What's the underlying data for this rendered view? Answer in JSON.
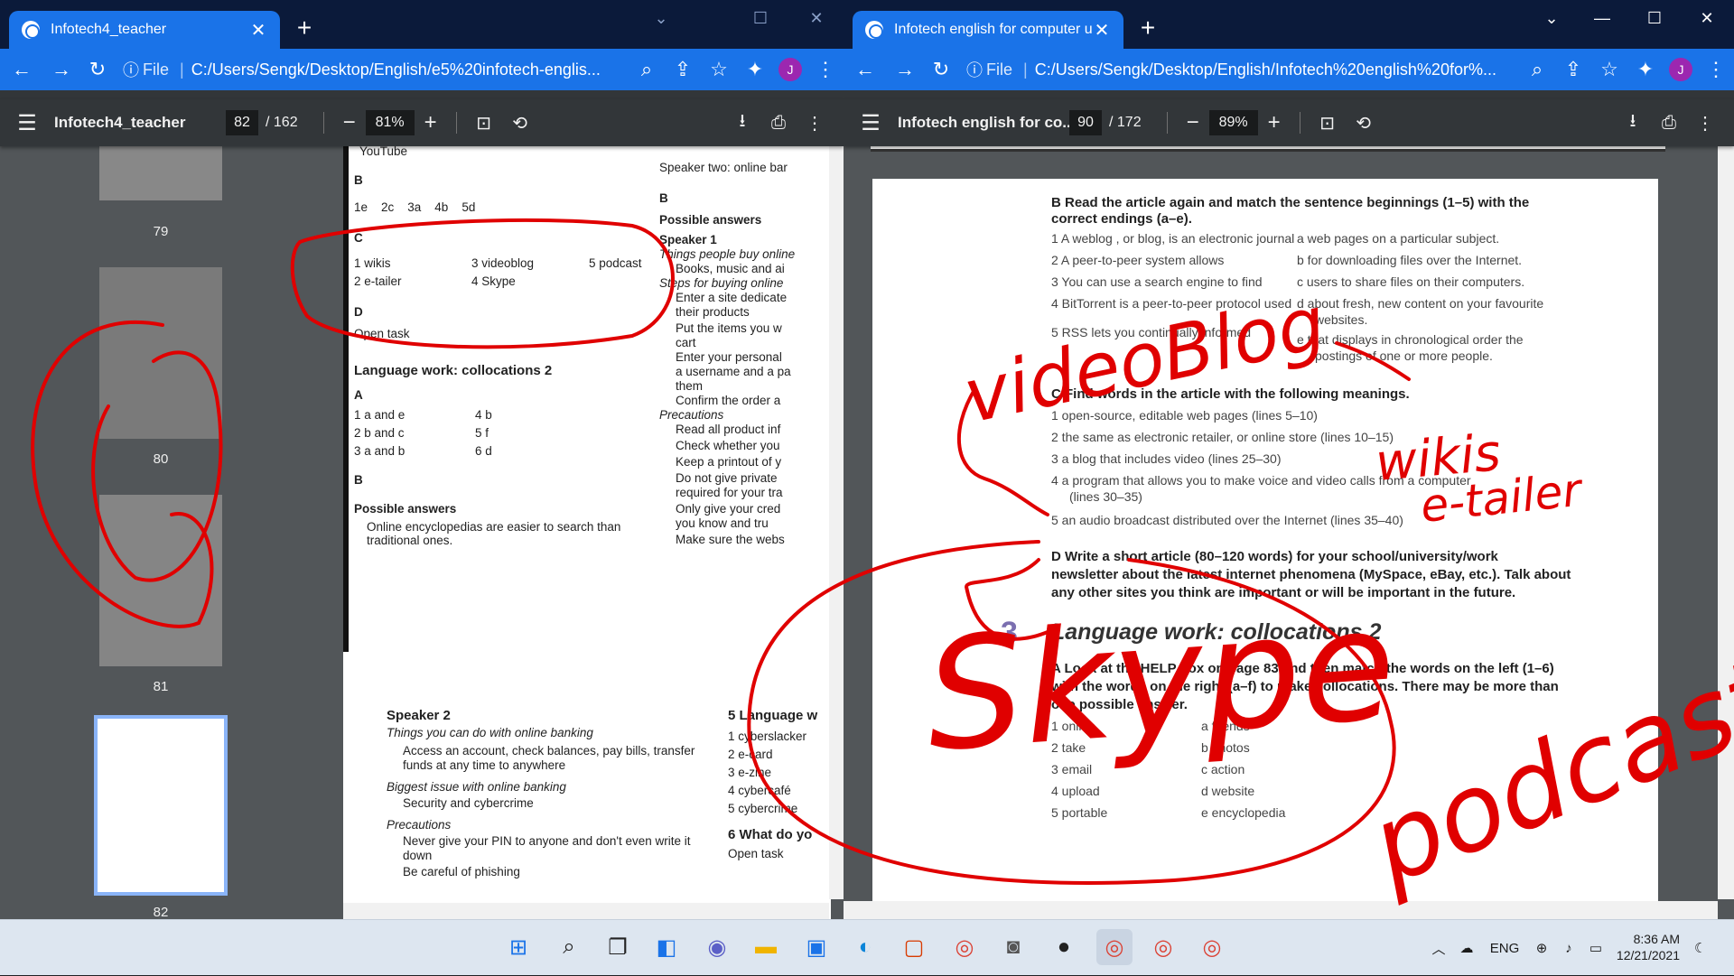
{
  "left_window": {
    "tab_title": "Infotech4_teacher",
    "url_scheme": "File",
    "url": "C:/Users/Sengk/Desktop/English/e5%20infotech-englis...",
    "avatar_letter": "J",
    "doc_name": "Infotech4_teacher",
    "page_current": "82",
    "page_total": "/ 162",
    "zoom": "81%",
    "thumbnails": [
      "79",
      "80",
      "81",
      "82"
    ],
    "page_top": {
      "youtube": "YouTube",
      "b_label": "B",
      "b_answers": "1e    2c    3a    4b    5d",
      "c_label": "C",
      "c1": "1  wikis",
      "c2": "2  e-tailer",
      "c3": "3  videoblog",
      "c4": "4  Skype",
      "c5": "5  podcast",
      "d_label": "D",
      "open_task": "Open task",
      "lw_heading": "Language work: collocations 2",
      "a_label": "A",
      "a1": "1  a and e",
      "a2": "2  b and c",
      "a3": "3  a and b",
      "a4": "4  b",
      "a5": "5  f",
      "a6": "6  d",
      "b2_label": "B",
      "possible_answers": "Possible answers",
      "pa_bullet": "Online encyclopedias are easier to search than traditional ones.",
      "r_speaker2_top": "Speaker two: online bar",
      "r_b": "B",
      "r_possible": "Possible answers",
      "r_speaker1": "Speaker 1",
      "r_things": "Things people buy online",
      "r_bul1": "Books, music and ai",
      "r_steps": "Steps for buying online",
      "r_bul2": "Enter a site dedicate",
      "r_bul2b": "their products",
      "r_bul3": "Put the items you w",
      "r_bul3b": "cart",
      "r_bul4": "Enter your personal",
      "r_bul4b": "a username and a pa",
      "r_bul4c": "them",
      "r_bul5": "Confirm the order a",
      "r_precautions": "Precautions",
      "r_bul6": "Read all product inf",
      "r_bul7": "Check whether you",
      "r_bul8": "Keep a printout of y",
      "r_bul9": "Do not give private",
      "r_bul9b": "required for your tra",
      "r_bul10": "Only give your cred",
      "r_bul10b": "you know and tru",
      "r_bul11": "Make sure the webs"
    },
    "page_bottom": {
      "speaker2": "Speaker 2",
      "things": "Things you can do with online banking",
      "bul1": "Access an account, check balances, pay bills, transfer",
      "bul1b": "funds at any time to anywhere",
      "biggest": "Biggest issue with online banking",
      "bul2": "Security and cybercrime",
      "precautions": "Precautions",
      "bul3": "Never give your PIN to anyone and don't even write it",
      "bul3b": "down",
      "bul4": "Be careful of phishing",
      "r5": "5  Language w",
      "r5_1": "1  cyberslacker",
      "r5_2": "2  e-card",
      "r5_3": "3  e-zine",
      "r5_4": "4  cybercafé",
      "r5_5": "5  cybercrime",
      "r6": "6  What do yo",
      "r6_open": "Open task"
    }
  },
  "right_window": {
    "tab_title": "Infotech english for computer us",
    "url_scheme": "File",
    "url": "C:/Users/Sengk/Desktop/English/Infotech%20english%20for%...",
    "avatar_letter": "J",
    "doc_name": "Infotech english for co...",
    "page_current": "90",
    "page_total": "/ 172",
    "zoom": "89%",
    "page": {
      "b_heading": "B  Read the article again and match the sentence beginnings (1–5) with the",
      "b_heading2": "correct endings (a–e).",
      "b1": "1   A weblog , or blog, is an electronic journal",
      "b2": "2   A peer-to-peer system allows",
      "b3": "3   You can use a search engine to find",
      "b4": "4   BitTorrent is a peer-to-peer protocol used",
      "b5": "5   RSS lets you continually informed",
      "ba": "a   web pages on a particular subject.",
      "bb": "b   for downloading files over the Internet.",
      "bc": "c   users to share files on their computers.",
      "bd": "d   about fresh, new content on your favourite",
      "bd2": "websites.",
      "be": "e   that displays in chronological order the",
      "be2": "postings of one or more people.",
      "c_heading": "C  Find words in the article with the following meanings.",
      "c1": "1   open-source, editable web pages (lines 5–10)",
      "c2": "2   the same as electronic retailer, or online store (lines 10–15)",
      "c3": "3   a blog that includes video (lines 25–30)",
      "c4": "4   a program that allows you to make voice and video calls from a computer",
      "c4b": "(lines 30–35)",
      "c5": "5   an audio broadcast distributed over the Internet (lines 35–40)",
      "d_heading": "D  Write a short article (80–120 words) for your school/university/work",
      "d_heading2": "newsletter about the latest internet phenomena (MySpace, eBay, etc.). Talk about",
      "d_heading3": "any other sites you think are important or will be important in the future.",
      "section_num": "3",
      "lw_heading": "Language work: collocations 2",
      "a_heading": "A  Look at the HELP box on page 83 and then match the words on the left (1–6)",
      "a_heading2": "with the words on the right (a–f) to make collocations. There may be more than",
      "a_heading3": "one possible answer.",
      "a1": "1   online",
      "a2": "2   take",
      "a3": "3   email",
      "a4": "4   upload",
      "a5": "5   portable",
      "aa": "a   friends",
      "ab": "b   photos",
      "ac": "c   action",
      "ad": "d   website",
      "ae": "e   encyclopedia"
    }
  },
  "ink_words": [
    "videoBlog",
    "wikis",
    "e-tailer",
    "Skype",
    "podcast"
  ],
  "taskbar": {
    "apps": [
      "start-icon",
      "search-icon",
      "task-view-icon",
      "widgets-icon",
      "teams-chat-icon",
      "file-explorer-icon",
      "store-icon",
      "edge-icon",
      "office-icon",
      "chrome-icon",
      "camera-icon",
      "obs-icon",
      "chrome-profile-icon",
      "chrome-icon-2",
      "chrome-icon-3"
    ],
    "lang": "ENG",
    "time": "8:36 AM",
    "date": "12/21/2021"
  },
  "colors": {
    "ink": "#e00000",
    "chrome_tab": "#1a73e8",
    "title_bar": "#0b1a3a",
    "pdf_toolbar": "#323639",
    "pdf_bg": "#525659"
  }
}
